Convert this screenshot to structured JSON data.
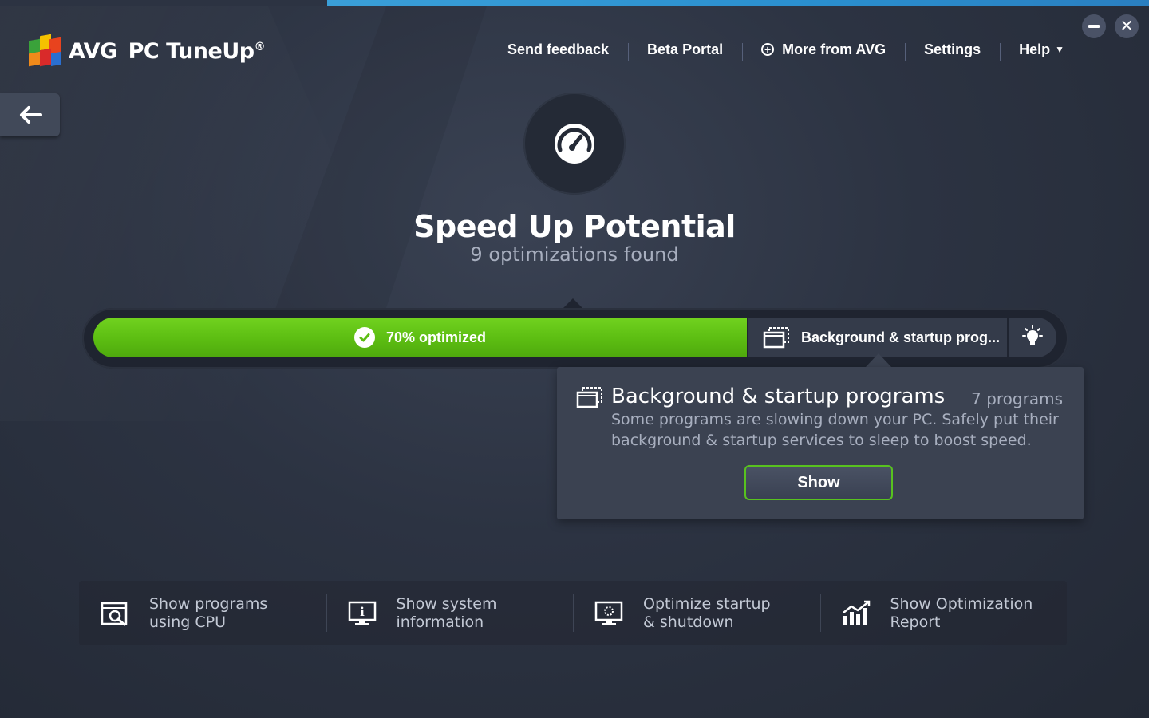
{
  "app": {
    "brand": "AVG",
    "product": "PC TuneUp",
    "trademark": "®"
  },
  "nav": {
    "send_feedback": "Send feedback",
    "beta_portal": "Beta Portal",
    "more_from_avg": "More from AVG",
    "settings": "Settings",
    "help": "Help"
  },
  "main": {
    "title": "Speed Up Potential",
    "subtitle": "9 optimizations found",
    "progress_label": "70% optimized",
    "progress_value": 0.7,
    "current_stage_label": "Background & startup prog..."
  },
  "popover": {
    "title": "Background & startup programs",
    "count": "7 programs",
    "description": "Some programs are slowing down your PC. Safely put their background & startup services to sleep to boost speed.",
    "button": "Show"
  },
  "actions": [
    {
      "label": "Show programs\nusing CPU",
      "icon": "cpu-search-icon"
    },
    {
      "label": "Show system\ninformation",
      "icon": "system-info-icon"
    },
    {
      "label": "Optimize startup\n& shutdown",
      "icon": "startup-monitor-icon"
    },
    {
      "label": "Show Optimization\nReport",
      "icon": "report-chart-icon"
    }
  ],
  "colors": {
    "accent_green": "#5cbd12",
    "accent_blue": "#2a8fcf",
    "background": "#2c3342"
  }
}
